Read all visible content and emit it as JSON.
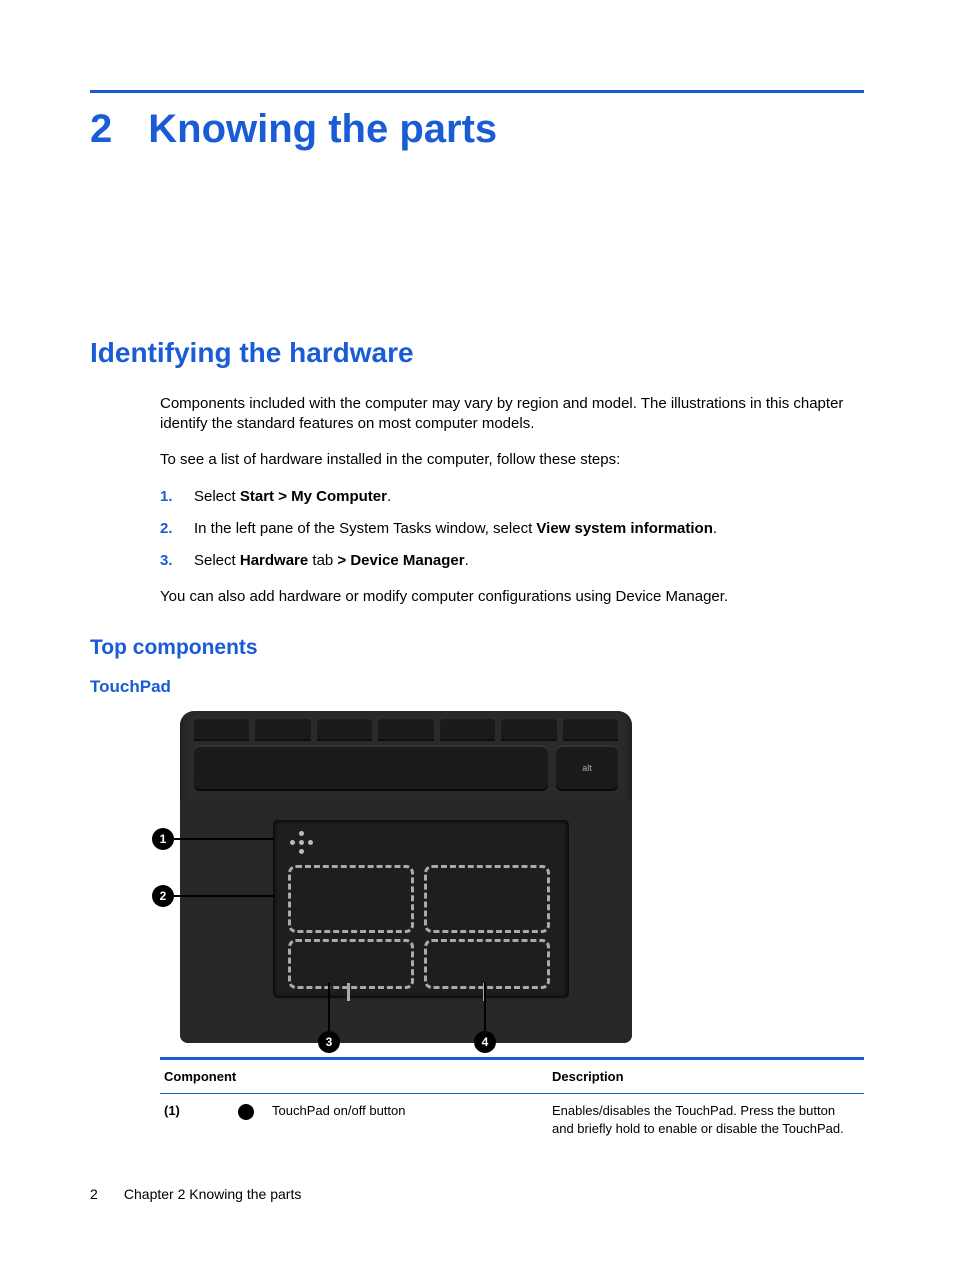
{
  "chapter": {
    "number": "2",
    "title": "Knowing the parts"
  },
  "section": {
    "title": "Identifying the hardware"
  },
  "intro": {
    "p1": "Components included with the computer may vary by region and model. The illustrations in this chapter identify the standard features on most computer models.",
    "p2": "To see a list of hardware installed in the computer, follow these steps:"
  },
  "steps": [
    {
      "pre": "Select ",
      "bold": "Start > My Computer",
      "post": "."
    },
    {
      "pre": "In the left pane of the System Tasks window, select ",
      "bold": "View system information",
      "post": "."
    },
    {
      "pre": "Select ",
      "bold": "Hardware",
      "mid": " tab ",
      "bold2": "> Device Manager",
      "post": "."
    }
  ],
  "after_steps": "You can also add hardware or modify computer configurations using Device Manager.",
  "subsection": {
    "h2": "Top components",
    "h3": "TouchPad"
  },
  "illustration": {
    "alt_key": "alt",
    "callouts": {
      "c1": "1",
      "c2": "2",
      "c3": "3",
      "c4": "4"
    }
  },
  "table": {
    "headers": {
      "component": "Component",
      "description": "Description"
    },
    "rows": [
      {
        "num": "(1)",
        "icon": "dot-icon",
        "name": "TouchPad on/off button",
        "desc": "Enables/disables the TouchPad. Press the button and briefly hold to enable or disable the TouchPad."
      }
    ]
  },
  "footer": {
    "page": "2",
    "label": "Chapter 2   Knowing the parts"
  }
}
